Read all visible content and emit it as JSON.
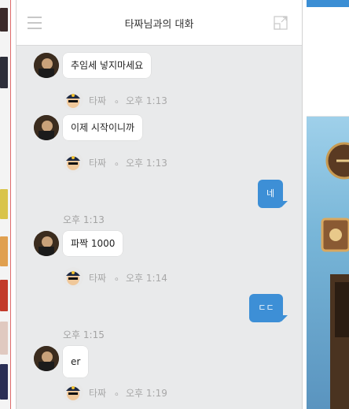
{
  "chat": {
    "title": "타짜님과의 대화"
  },
  "messages": [
    {
      "text": "추임세 넣지마세요",
      "sender": "타짜",
      "separator": "。",
      "time": "오후 1:13"
    },
    {
      "text": "이제 시작이니까",
      "sender": "타짜",
      "separator": "。",
      "time": "오후 1:13"
    },
    {
      "text": "파짝 1000",
      "sender": "타짜",
      "separator": "。",
      "time": "오후 1:14"
    },
    {
      "text": "er",
      "sender": "타짜",
      "separator": "。",
      "time": "오후 1:19"
    }
  ],
  "outgoing": [
    {
      "text": "네",
      "time": "오후 1:13"
    },
    {
      "text": "ㄷㄷ",
      "time": "오후 1:15"
    }
  ],
  "colors": {
    "outgoing_bubble": "#3d8fd6",
    "chat_background": "#e9eaeb"
  },
  "icons": [
    "menu-icon",
    "expand-icon"
  ]
}
